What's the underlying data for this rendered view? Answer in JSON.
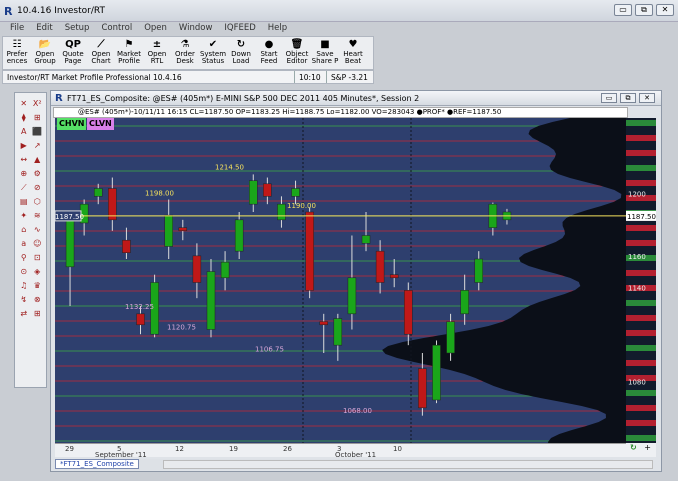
{
  "app": {
    "title": "10.4.16 Investor/RT",
    "logo": "R"
  },
  "window_buttons": [
    "▭",
    "⧉",
    "✕"
  ],
  "menu": [
    "File",
    "Edit",
    "Setup",
    "Control",
    "Open",
    "Window",
    "IQFEED",
    "Help"
  ],
  "toolbar": [
    {
      "icon": "☷",
      "l1": "Prefer",
      "l2": "ences"
    },
    {
      "icon": "📂",
      "l1": "Open",
      "l2": "Group"
    },
    {
      "icon": "QP",
      "l1": "Quote",
      "l2": "Page"
    },
    {
      "icon": "⟋",
      "l1": "Open",
      "l2": "Chart"
    },
    {
      "icon": "⚑",
      "l1": "Market",
      "l2": "Profile"
    },
    {
      "icon": "±",
      "l1": "Open",
      "l2": "RTL"
    },
    {
      "icon": "⚗",
      "l1": "Order",
      "l2": "Desk"
    },
    {
      "icon": "✔",
      "l1": "System",
      "l2": "Status"
    },
    {
      "icon": "↻",
      "l1": "Down",
      "l2": "Load"
    },
    {
      "icon": "●",
      "l1": "Start",
      "l2": "Feed"
    },
    {
      "icon": "🗑",
      "l1": "Object",
      "l2": "Editor"
    },
    {
      "icon": "■",
      "l1": "Save",
      "l2": "Share P"
    },
    {
      "icon": "♥",
      "l1": "Heart",
      "l2": "Beat"
    }
  ],
  "status": {
    "text": "Investor/RT Market Profile Professional 10.4.16",
    "time": "10:10",
    "index": "S&P  -3.21"
  },
  "chart_window": {
    "title": "FT71_ES_Composite: @ES# (405m*) E-MINI S&P 500 DEC 2011 405 Minutes*, Session 2",
    "info": "@ES# (405m*)-10/11/11 16:15 CL=1187.50 OP=1183.25 Hi=1188.75 Lo=1182.00 VO=283043  ●PROF* ●REF=1187.50",
    "tags": [
      {
        "text": "CHVN",
        "bg": "#55e065"
      },
      {
        "text": "CLVN",
        "bg": "#d880e8"
      }
    ],
    "tab": "*FT71_ES_Composite",
    "price_marker": "1187.50"
  },
  "chart_data": {
    "type": "candlestick",
    "xlabel": "",
    "ylabel": "",
    "ylim": [
      1040,
      1250
    ],
    "x_ticks": [
      "29",
      "5",
      "12",
      "19",
      "26",
      "3",
      "10"
    ],
    "x_sublabels": [
      "September '11",
      "October '11"
    ],
    "y_ticks": [
      "1200",
      "1160",
      "1140",
      "1080"
    ],
    "price_labels": [
      "1214.50",
      "1198.00",
      "1190.00",
      "1132.25",
      "1120.75",
      "1106.75",
      "1068.00",
      "1187.50"
    ],
    "candles": [
      {
        "o": 1155,
        "c": 1185,
        "h": 1190,
        "l": 1130,
        "up": true
      },
      {
        "o": 1183,
        "c": 1195,
        "h": 1198,
        "l": 1175,
        "up": true
      },
      {
        "o": 1200,
        "c": 1205,
        "h": 1208,
        "l": 1195,
        "up": true
      },
      {
        "o": 1205,
        "c": 1185,
        "h": 1212,
        "l": 1178,
        "up": false
      },
      {
        "o": 1172,
        "c": 1164,
        "h": 1180,
        "l": 1160,
        "up": false
      },
      {
        "o": 1125,
        "c": 1118,
        "h": 1130,
        "l": 1112,
        "up": false
      },
      {
        "o": 1112,
        "c": 1145,
        "h": 1150,
        "l": 1110,
        "up": true
      },
      {
        "o": 1168,
        "c": 1188,
        "h": 1198,
        "l": 1160,
        "up": true
      },
      {
        "o": 1180,
        "c": 1178,
        "h": 1185,
        "l": 1172,
        "up": false
      },
      {
        "o": 1162,
        "c": 1145,
        "h": 1170,
        "l": 1135,
        "up": false
      },
      {
        "o": 1115,
        "c": 1152,
        "h": 1160,
        "l": 1110,
        "up": true
      },
      {
        "o": 1148,
        "c": 1158,
        "h": 1165,
        "l": 1140,
        "up": true
      },
      {
        "o": 1165,
        "c": 1185,
        "h": 1190,
        "l": 1160,
        "up": true
      },
      {
        "o": 1195,
        "c": 1210,
        "h": 1214,
        "l": 1190,
        "up": true
      },
      {
        "o": 1208,
        "c": 1200,
        "h": 1212,
        "l": 1195,
        "up": false
      },
      {
        "o": 1185,
        "c": 1195,
        "h": 1200,
        "l": 1180,
        "up": true
      },
      {
        "o": 1200,
        "c": 1205,
        "h": 1210,
        "l": 1195,
        "up": true
      },
      {
        "o": 1190,
        "c": 1140,
        "h": 1193,
        "l": 1135,
        "up": false
      },
      {
        "o": 1120,
        "c": 1118,
        "h": 1125,
        "l": 1100,
        "up": false
      },
      {
        "o": 1105,
        "c": 1122,
        "h": 1125,
        "l": 1095,
        "up": true
      },
      {
        "o": 1125,
        "c": 1148,
        "h": 1175,
        "l": 1115,
        "up": true
      },
      {
        "o": 1170,
        "c": 1175,
        "h": 1190,
        "l": 1165,
        "up": true
      },
      {
        "o": 1165,
        "c": 1145,
        "h": 1172,
        "l": 1138,
        "up": false
      },
      {
        "o": 1150,
        "c": 1148,
        "h": 1160,
        "l": 1142,
        "up": false
      },
      {
        "o": 1140,
        "c": 1112,
        "h": 1145,
        "l": 1105,
        "up": false
      },
      {
        "o": 1090,
        "c": 1065,
        "h": 1100,
        "l": 1060,
        "up": false
      },
      {
        "o": 1070,
        "c": 1105,
        "h": 1108,
        "l": 1068,
        "up": true
      },
      {
        "o": 1100,
        "c": 1120,
        "h": 1125,
        "l": 1095,
        "up": true
      },
      {
        "o": 1125,
        "c": 1140,
        "h": 1150,
        "l": 1118,
        "up": true
      },
      {
        "o": 1145,
        "c": 1160,
        "h": 1165,
        "l": 1140,
        "up": true
      },
      {
        "o": 1180,
        "c": 1195,
        "h": 1196,
        "l": 1175,
        "up": true
      },
      {
        "o": 1185,
        "c": 1190,
        "h": 1192,
        "l": 1182,
        "up": true
      }
    ]
  },
  "left_tools": [
    "✕",
    "X²",
    "⧫",
    "⊞",
    "A",
    "⬛",
    "▶",
    "↗",
    "↔",
    "▲",
    "⊕",
    "⚙",
    "⟋",
    "⊘",
    "▤",
    "⬡",
    "✦",
    "≋",
    "⌂",
    "∿",
    "a",
    "☺",
    "⚲",
    "⊡",
    "⊙",
    "◈",
    "♫",
    "♛",
    "↯",
    "⊗",
    "⇄",
    "⊞"
  ],
  "colors": {
    "up": "#1aa61a",
    "down": "#c01818",
    "bg": "#2e3f6e",
    "accent": "#f7e35d"
  }
}
